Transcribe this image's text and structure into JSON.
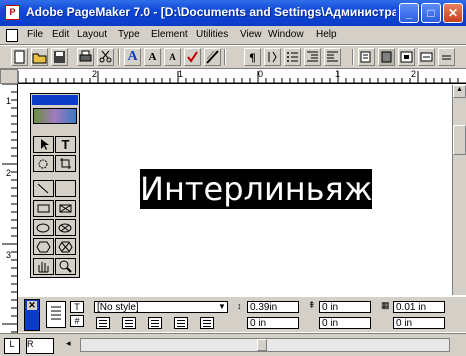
{
  "window": {
    "title": "Adobe PageMaker 7.0 - [D:\\Documents and Settings\\Администра...",
    "app_icon_glyph": "P",
    "minimize_glyph": "_",
    "maximize_glyph": "□",
    "close_glyph": "✕"
  },
  "menu": {
    "items": [
      "File",
      "Edit",
      "Layout",
      "Type",
      "Element",
      "Utilities",
      "View",
      "Window",
      "Help"
    ]
  },
  "toolbar": {
    "type_glyphs": [
      "A",
      "A",
      "A"
    ],
    "paragraph_glyph": "¶"
  },
  "rulers": {
    "h_labels": [
      "2",
      "1",
      "0",
      "1",
      "2",
      "3"
    ],
    "v_labels": [
      "1",
      "2",
      "3"
    ]
  },
  "toolbox": {
    "text_tool_glyph": "T"
  },
  "document": {
    "heading_text": "Интерлиньяж"
  },
  "control_palette": {
    "style_value": "[No style]",
    "leading_value": "0.39in",
    "left_indent": "0 in",
    "right_indent": "0 in",
    "space_before": "0 in",
    "space_after": "0 in",
    "grid_size": "0.01 in",
    "align_first": "0 in"
  },
  "pages": {
    "page_l": "L",
    "page_r": "R"
  },
  "colors": {
    "titlebar": "#1048d8",
    "chrome": "#d4d0c8",
    "heading_bg": "#000000",
    "heading_fg": "#ffffff"
  }
}
